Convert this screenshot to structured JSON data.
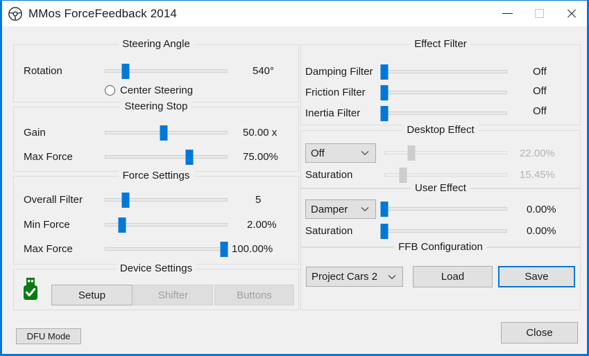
{
  "window": {
    "title": "MMos ForceFeedback 2014",
    "icon": "steering-wheel-icon",
    "accent_color": "#0078d7",
    "background_color": "#f0f0f0",
    "controls": {
      "minimize": "minimize-icon",
      "maximize": "maximize-icon",
      "close": "close-icon"
    }
  },
  "steering_angle": {
    "title": "Steering Angle",
    "rotation": {
      "label": "Rotation",
      "value": "540°",
      "percent": 17
    },
    "center_steering": {
      "label": "Center Steering",
      "checked": false
    }
  },
  "steering_stop": {
    "title": "Steering Stop",
    "gain": {
      "label": "Gain",
      "value": "50.00 x",
      "percent": 48
    },
    "max_force": {
      "label": "Max Force",
      "value": "75.00%",
      "percent": 69
    }
  },
  "force_settings": {
    "title": "Force Settings",
    "overall_filter": {
      "label": "Overall Filter",
      "value": "5",
      "percent": 17
    },
    "min_force": {
      "label": "Min Force",
      "value": "2.00%",
      "percent": 14
    },
    "max_force": {
      "label": "Max Force",
      "value": "100.00%",
      "percent": 97
    }
  },
  "device_settings": {
    "title": "Device Settings",
    "status_icon": "usb-device-connected-icon",
    "setup_button": {
      "label": "Setup",
      "enabled": true
    },
    "shifter_button": {
      "label": "Shifter",
      "enabled": false
    },
    "buttons_button": {
      "label": "Buttons",
      "enabled": false
    }
  },
  "effect_filter": {
    "title": "Effect Filter",
    "damping": {
      "label": "Damping Filter",
      "value": "Off",
      "percent": 0
    },
    "friction": {
      "label": "Friction Filter",
      "value": "Off",
      "percent": 0
    },
    "inertia": {
      "label": "Inertia Filter",
      "value": "Off",
      "percent": 0
    }
  },
  "desktop_effect": {
    "title": "Desktop Effect",
    "enabled": false,
    "effect_select": {
      "value": "Off"
    },
    "strength": {
      "value": "22.00%",
      "percent": 22
    },
    "saturation": {
      "label": "Saturation",
      "value": "15.45%",
      "percent": 15
    }
  },
  "user_effect": {
    "title": "User Effect",
    "effect_select": {
      "value": "Damper"
    },
    "strength": {
      "value": "0.00%",
      "percent": 0
    },
    "saturation": {
      "label": "Saturation",
      "value": "0.00%",
      "percent": 0
    }
  },
  "ffb_configuration": {
    "title": "FFB Configuration",
    "profile_select": {
      "value": "Project Cars 2"
    },
    "load_button": {
      "label": "Load"
    },
    "save_button": {
      "label": "Save",
      "focused": true
    }
  },
  "footer": {
    "dfu_button": {
      "label": "DFU Mode"
    },
    "close_button": {
      "label": "Close"
    }
  }
}
